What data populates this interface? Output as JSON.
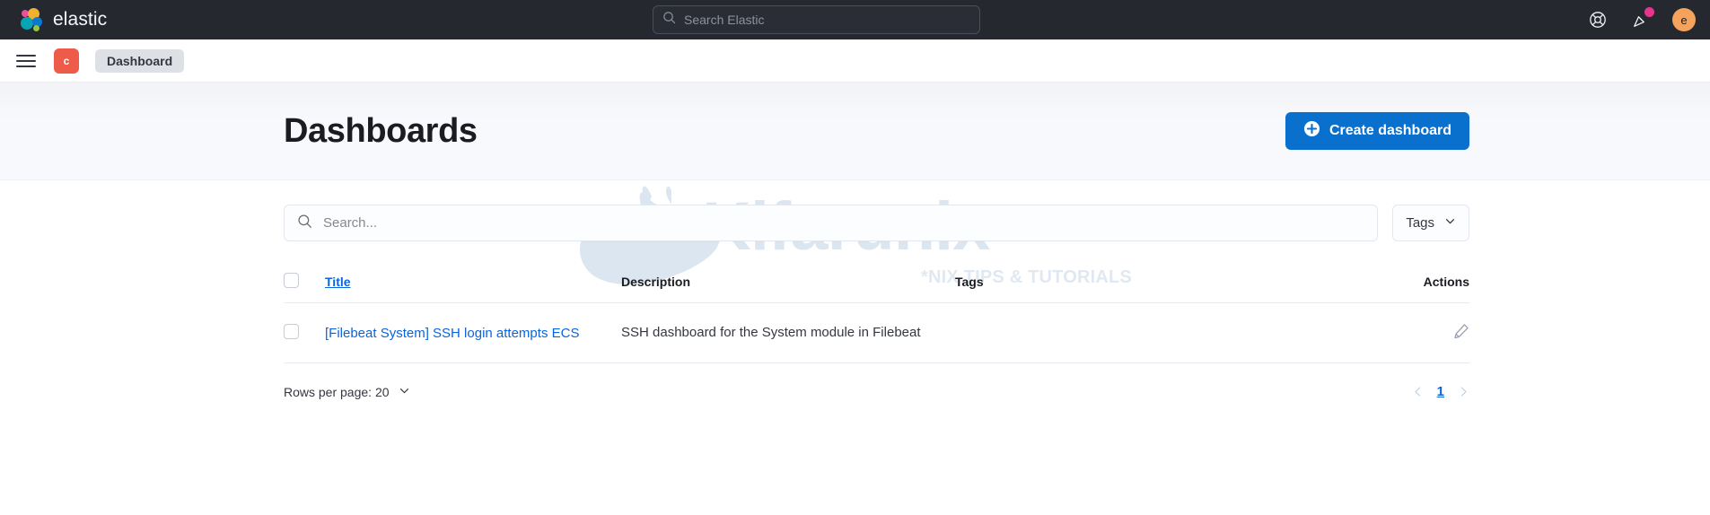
{
  "chrome": {
    "brand_name": "elastic",
    "logo_icon": "elastic-logo-icon",
    "search": {
      "placeholder": "Search Elastic",
      "value": "",
      "icon": "search-icon"
    },
    "help_icon": "lifebuoy-help-icon",
    "news_icon": "party-popper-announcements-icon",
    "news_badge": true,
    "avatar_initial": "e",
    "avatar_color": "#F5A35C"
  },
  "breadcrumb_bar": {
    "menu_icon": "hamburger-menu-icon",
    "space_initial": "c",
    "space_color": "#EE5B48",
    "crumbs": [
      "Dashboard"
    ]
  },
  "page_header": {
    "title": "Dashboards",
    "create_button": {
      "label": "Create dashboard",
      "icon": "plus-in-circle-icon",
      "color": "#0A70CE"
    }
  },
  "filters": {
    "search": {
      "placeholder": "Search...",
      "value": "",
      "icon": "search-icon"
    },
    "tags": {
      "label": "Tags",
      "icon": "chevron-down-icon"
    }
  },
  "table": {
    "columns": [
      {
        "key": "title",
        "label": "Title",
        "sortable": true
      },
      {
        "key": "description",
        "label": "Description",
        "sortable": false
      },
      {
        "key": "tags",
        "label": "Tags",
        "sortable": false
      },
      {
        "key": "actions",
        "label": "Actions",
        "sortable": false
      }
    ],
    "rows": [
      {
        "title": "[Filebeat System] SSH login attempts ECS",
        "description": "SSH dashboard for the System module in Filebeat",
        "tags": "",
        "action_icon": "pencil-edit-icon"
      }
    ]
  },
  "footer": {
    "rows_per_page_label": "Rows per page: 20",
    "rows_per_page_icon": "chevron-down-icon",
    "prev_icon": "chevron-left-icon",
    "next_icon": "chevron-right-icon",
    "current_page": "1"
  },
  "watermark": {
    "text": "Kifarunix",
    "subtitle": "*NIX TIPS & TUTORIALS",
    "color": "#DCE6F0"
  }
}
